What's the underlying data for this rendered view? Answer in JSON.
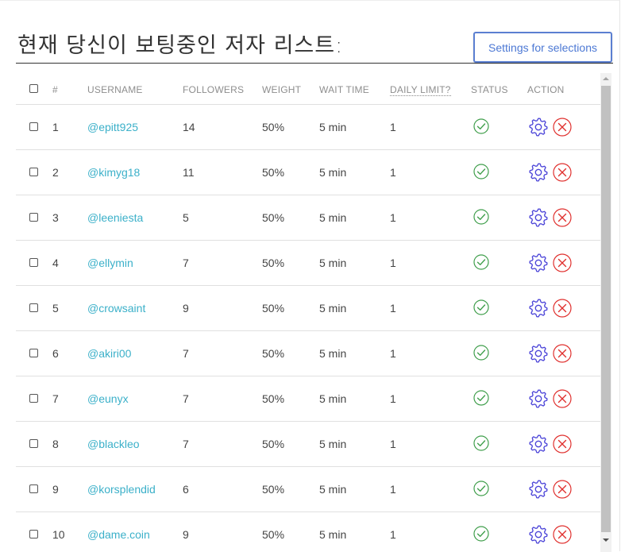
{
  "header": {
    "title": "현재 당신이 보팅중인 저자 리스트:",
    "settings_button": "Settings for selections"
  },
  "table": {
    "columns": {
      "num": "#",
      "username": "USERNAME",
      "followers": "FOLLOWERS",
      "weight": "WEIGHT",
      "wait_time": "WAIT TIME",
      "daily_limit": "DAILY LIMIT?",
      "status": "STATUS",
      "action": "ACTION"
    },
    "rows": [
      {
        "num": "1",
        "username": "@epitt925",
        "followers": "14",
        "weight": "50%",
        "wait": "5 min",
        "limit": "1"
      },
      {
        "num": "2",
        "username": "@kimyg18",
        "followers": "11",
        "weight": "50%",
        "wait": "5 min",
        "limit": "1"
      },
      {
        "num": "3",
        "username": "@leeniesta",
        "followers": "5",
        "weight": "50%",
        "wait": "5 min",
        "limit": "1"
      },
      {
        "num": "4",
        "username": "@ellymin",
        "followers": "7",
        "weight": "50%",
        "wait": "5 min",
        "limit": "1"
      },
      {
        "num": "5",
        "username": "@crowsaint",
        "followers": "9",
        "weight": "50%",
        "wait": "5 min",
        "limit": "1"
      },
      {
        "num": "6",
        "username": "@akiri00",
        "followers": "7",
        "weight": "50%",
        "wait": "5 min",
        "limit": "1"
      },
      {
        "num": "7",
        "username": "@eunyx",
        "followers": "7",
        "weight": "50%",
        "wait": "5 min",
        "limit": "1"
      },
      {
        "num": "8",
        "username": "@blackleo",
        "followers": "7",
        "weight": "50%",
        "wait": "5 min",
        "limit": "1"
      },
      {
        "num": "9",
        "username": "@korsplendid",
        "followers": "6",
        "weight": "50%",
        "wait": "5 min",
        "limit": "1"
      },
      {
        "num": "10",
        "username": "@dame.coin",
        "followers": "9",
        "weight": "50%",
        "wait": "5 min",
        "limit": "1"
      }
    ]
  },
  "icons": {
    "status": "check-circle-icon",
    "settings": "gear-icon",
    "remove": "x-circle-icon"
  },
  "colors": {
    "username": "#3bb0c9",
    "status_ok": "#3f9e4b",
    "gear": "#4a43d8",
    "remove": "#e0312f",
    "button_border": "#5b7fd1"
  }
}
